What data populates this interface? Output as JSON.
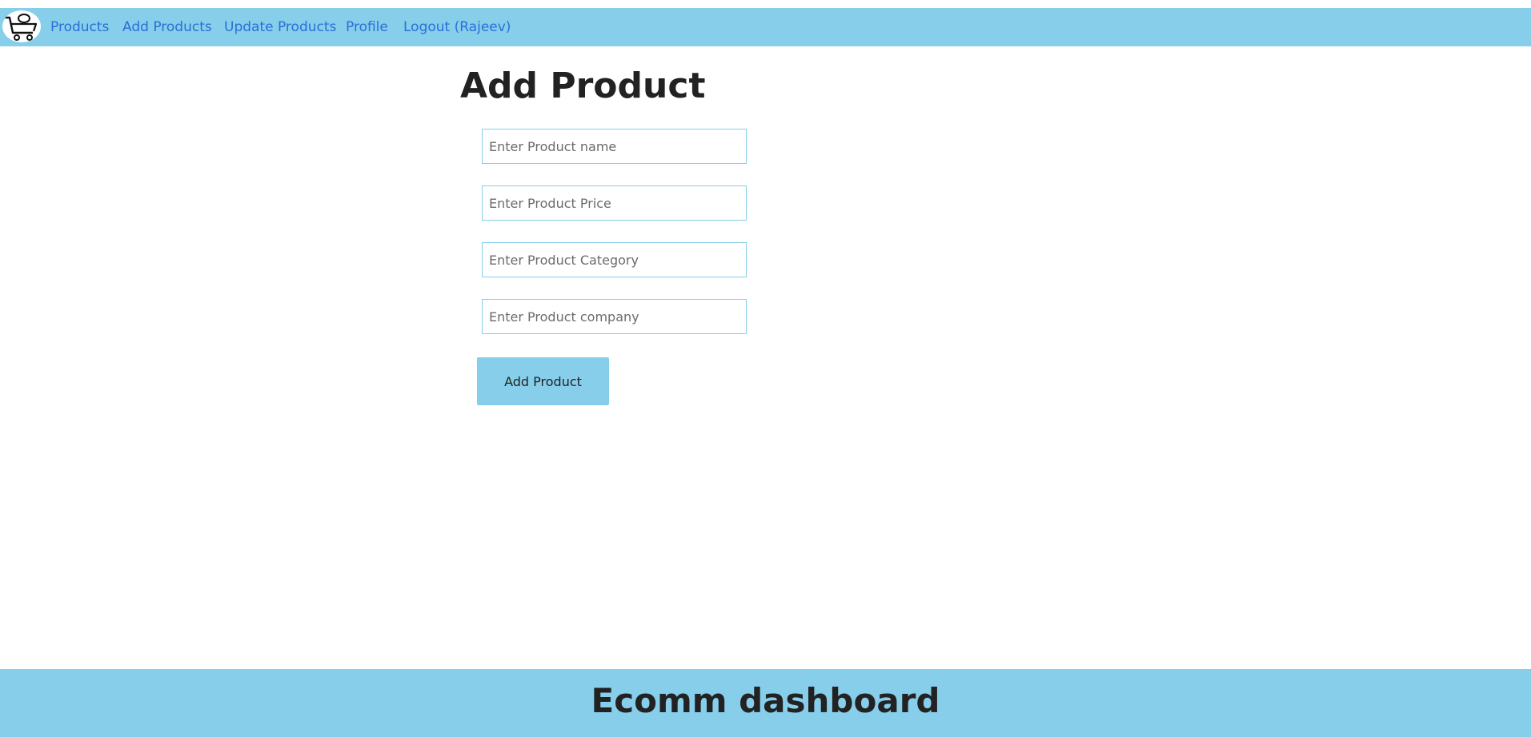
{
  "nav": {
    "logo": "cart-icon",
    "links": [
      "Products",
      "Add Products",
      "Update Products",
      "Profile",
      "Logout (Rajeev)"
    ]
  },
  "main": {
    "title": "Add Product",
    "fields": {
      "name_placeholder": "Enter Product name",
      "price_placeholder": "Enter Product Price",
      "category_placeholder": "Enter Product Category",
      "company_placeholder": "Enter Product company"
    },
    "submit_label": "Add Product"
  },
  "footer": {
    "title": "Ecomm dashboard"
  },
  "colors": {
    "bar": "#87ceeb",
    "link": "#2a6fd6"
  }
}
